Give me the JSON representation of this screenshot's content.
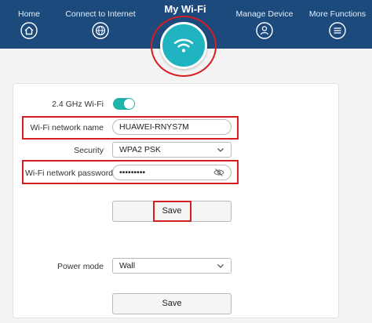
{
  "header": {
    "title": "My Wi-Fi",
    "nav": [
      {
        "label": "Home",
        "icon": "home-icon"
      },
      {
        "label": "Connect to Internet",
        "icon": "globe-icon"
      },
      {
        "label": "Manage Device",
        "icon": "user-icon"
      },
      {
        "label": "More Functions",
        "icon": "menu-icon"
      }
    ],
    "active_icon": "wifi-icon"
  },
  "form": {
    "wifi_band_label": "2.4 GHz Wi-Fi",
    "wifi_band_enabled": true,
    "network_name_label": "Wi-Fi network name",
    "network_name_value": "HUAWEI-RNYS7M",
    "security_label": "Security",
    "security_value": "WPA2 PSK",
    "password_label": "Wi-Fi network password",
    "password_value": "•••••••••",
    "save_label": "Save",
    "power_mode_label": "Power mode",
    "power_mode_value": "Wall",
    "save2_label": "Save"
  },
  "colors": {
    "header_bg": "#1c4a7c",
    "accent": "#1fb4c0",
    "toggle_on": "#20b3a9",
    "highlight_red": "#d51e24"
  }
}
